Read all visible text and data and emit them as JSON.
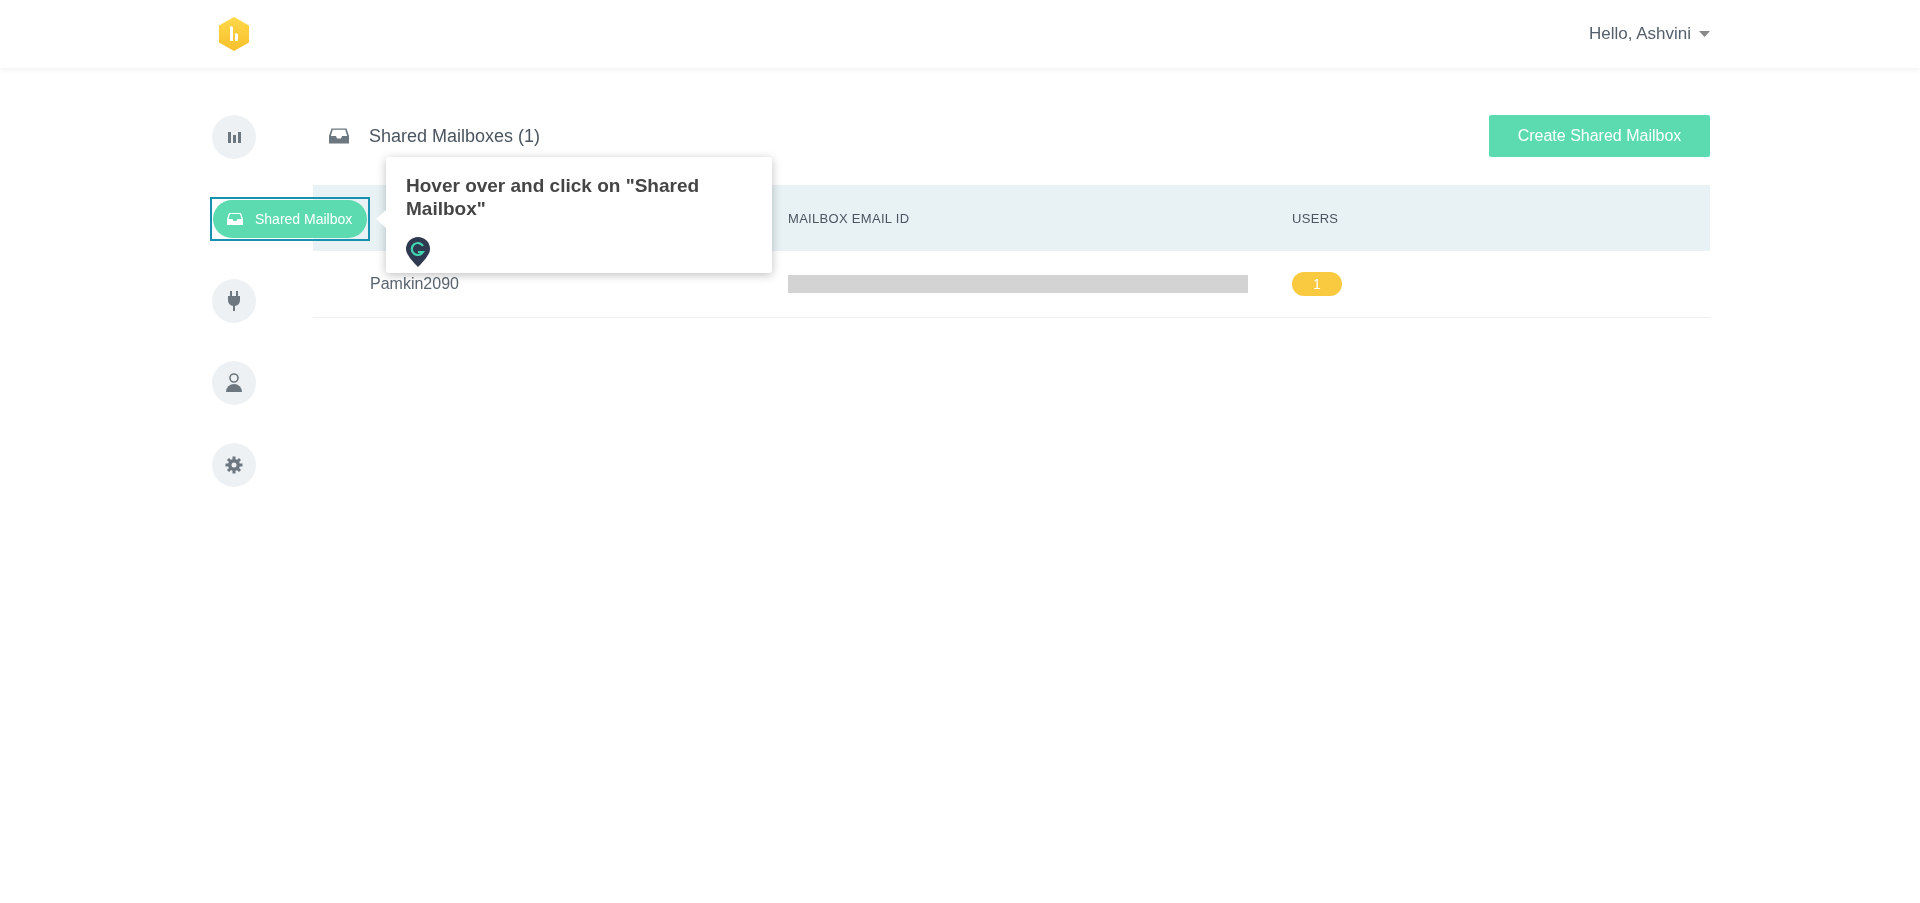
{
  "header": {
    "greeting": "Hello, Ashvini"
  },
  "sidebar": {
    "items": [
      {
        "selected": false,
        "highlighted": false
      },
      {
        "label": "Shared Mailbox",
        "selected": true,
        "highlighted": true
      },
      {
        "selected": false,
        "highlighted": false
      },
      {
        "selected": false,
        "highlighted": false
      },
      {
        "selected": false,
        "highlighted": false
      }
    ]
  },
  "page": {
    "title": "Shared Mailboxes (1)",
    "create_button": "Create Shared Mailbox"
  },
  "table": {
    "columns": [
      "MAILBOX EMAIL ID",
      "USERS"
    ],
    "rows": [
      {
        "name": "Pamkin2090",
        "email_redacted": true,
        "users": "1"
      }
    ]
  },
  "tooltip": {
    "text": "Hover over and click on \"Shared Mailbox\""
  }
}
